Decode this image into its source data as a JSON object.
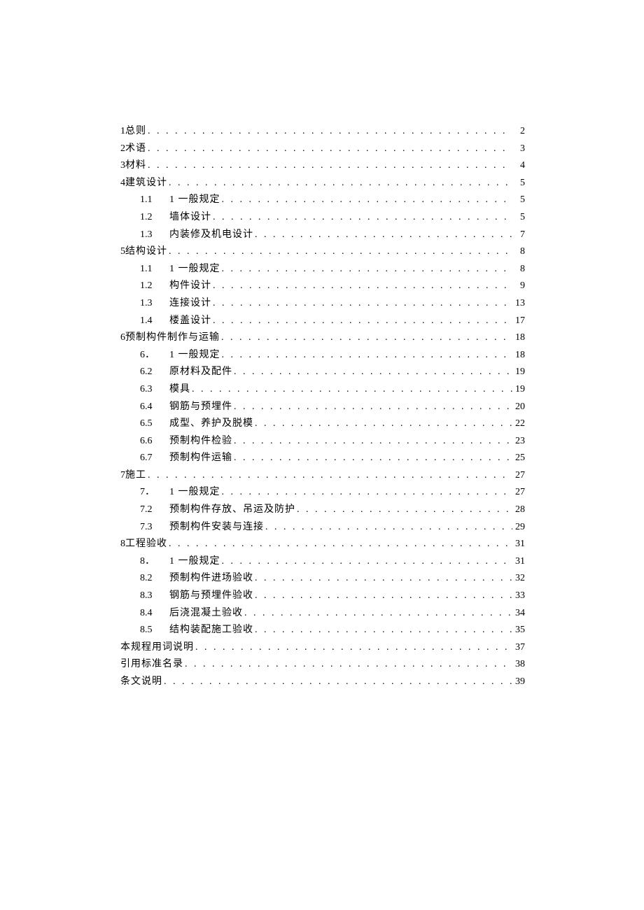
{
  "toc": [
    {
      "level": 0,
      "num": "1",
      "title": "总则",
      "page": "2"
    },
    {
      "level": 0,
      "num": "2",
      "title": "术语",
      "page": "3"
    },
    {
      "level": 0,
      "num": "3",
      "title": "材料",
      "page": "4"
    },
    {
      "level": 0,
      "num": "4",
      "title": "建筑设计",
      "page": "5"
    },
    {
      "level": 1,
      "num": "1.1",
      "title": "1 一般规定",
      "page": "5"
    },
    {
      "level": 1,
      "num": "1.2",
      "title": "墙体设计",
      "page": "5"
    },
    {
      "level": 1,
      "num": "1.3",
      "title": "内装修及机电设计",
      "page": "7"
    },
    {
      "level": 0,
      "num": "5",
      "title": "结构设计",
      "page": "8"
    },
    {
      "level": 1,
      "num": "1.1",
      "title": "1 一般规定",
      "page": "8"
    },
    {
      "level": 1,
      "num": "1.2",
      "title": "构件设计",
      "page": "9"
    },
    {
      "level": 1,
      "num": "1.3",
      "title": "连接设计",
      "page": "13"
    },
    {
      "level": 1,
      "num": "1.4",
      "title": "楼盖设计",
      "page": "17"
    },
    {
      "level": 0,
      "num": "6",
      "title": "预制构件制作与运输",
      "page": "18"
    },
    {
      "level": 1,
      "num": "6．",
      "title": "1 一般规定",
      "page": "18"
    },
    {
      "level": 1,
      "num": "6.2",
      "title": "原材料及配件",
      "page": "19"
    },
    {
      "level": 1,
      "num": "6.3",
      "title": "模具",
      "page": "19"
    },
    {
      "level": 1,
      "num": "6.4",
      "title": "钢筋与预埋件",
      "page": "20"
    },
    {
      "level": 1,
      "num": "6.5",
      "title": "成型、养护及脱模",
      "page": "22"
    },
    {
      "level": 1,
      "num": "6.6",
      "title": "预制构件检验",
      "page": "23"
    },
    {
      "level": 1,
      "num": "6.7",
      "title": "预制构件运输",
      "page": "25"
    },
    {
      "level": 0,
      "num": "7",
      "title": "施工",
      "page": "27"
    },
    {
      "level": 1,
      "num": "7．",
      "title": "1 一般规定",
      "page": "27"
    },
    {
      "level": 1,
      "num": "7.2",
      "title": "预制构件存放、吊运及防护",
      "page": "28"
    },
    {
      "level": 1,
      "num": "7.3",
      "title": "预制构件安装与连接",
      "page": "29"
    },
    {
      "level": 0,
      "num": "8",
      "title": "工程验收",
      "page": "31"
    },
    {
      "level": 1,
      "num": "8．",
      "title": "1 一般规定",
      "page": "31"
    },
    {
      "level": 1,
      "num": "8.2",
      "title": "预制构件进场验收",
      "page": "32"
    },
    {
      "level": 1,
      "num": "8.3",
      "title": "钢筋与预埋件验收",
      "page": "33"
    },
    {
      "level": 1,
      "num": "8.4",
      "title": "后浇混凝土验收",
      "page": "34"
    },
    {
      "level": 1,
      "num": "8.5",
      "title": "结构装配施工验收",
      "page": "35"
    },
    {
      "level": 0,
      "num": "",
      "title": "本规程用词说明",
      "page": "37"
    },
    {
      "level": 0,
      "num": "",
      "title": "引用标准名录",
      "page": "38"
    },
    {
      "level": 0,
      "num": "",
      "title": "条文说明",
      "page": "39"
    }
  ]
}
